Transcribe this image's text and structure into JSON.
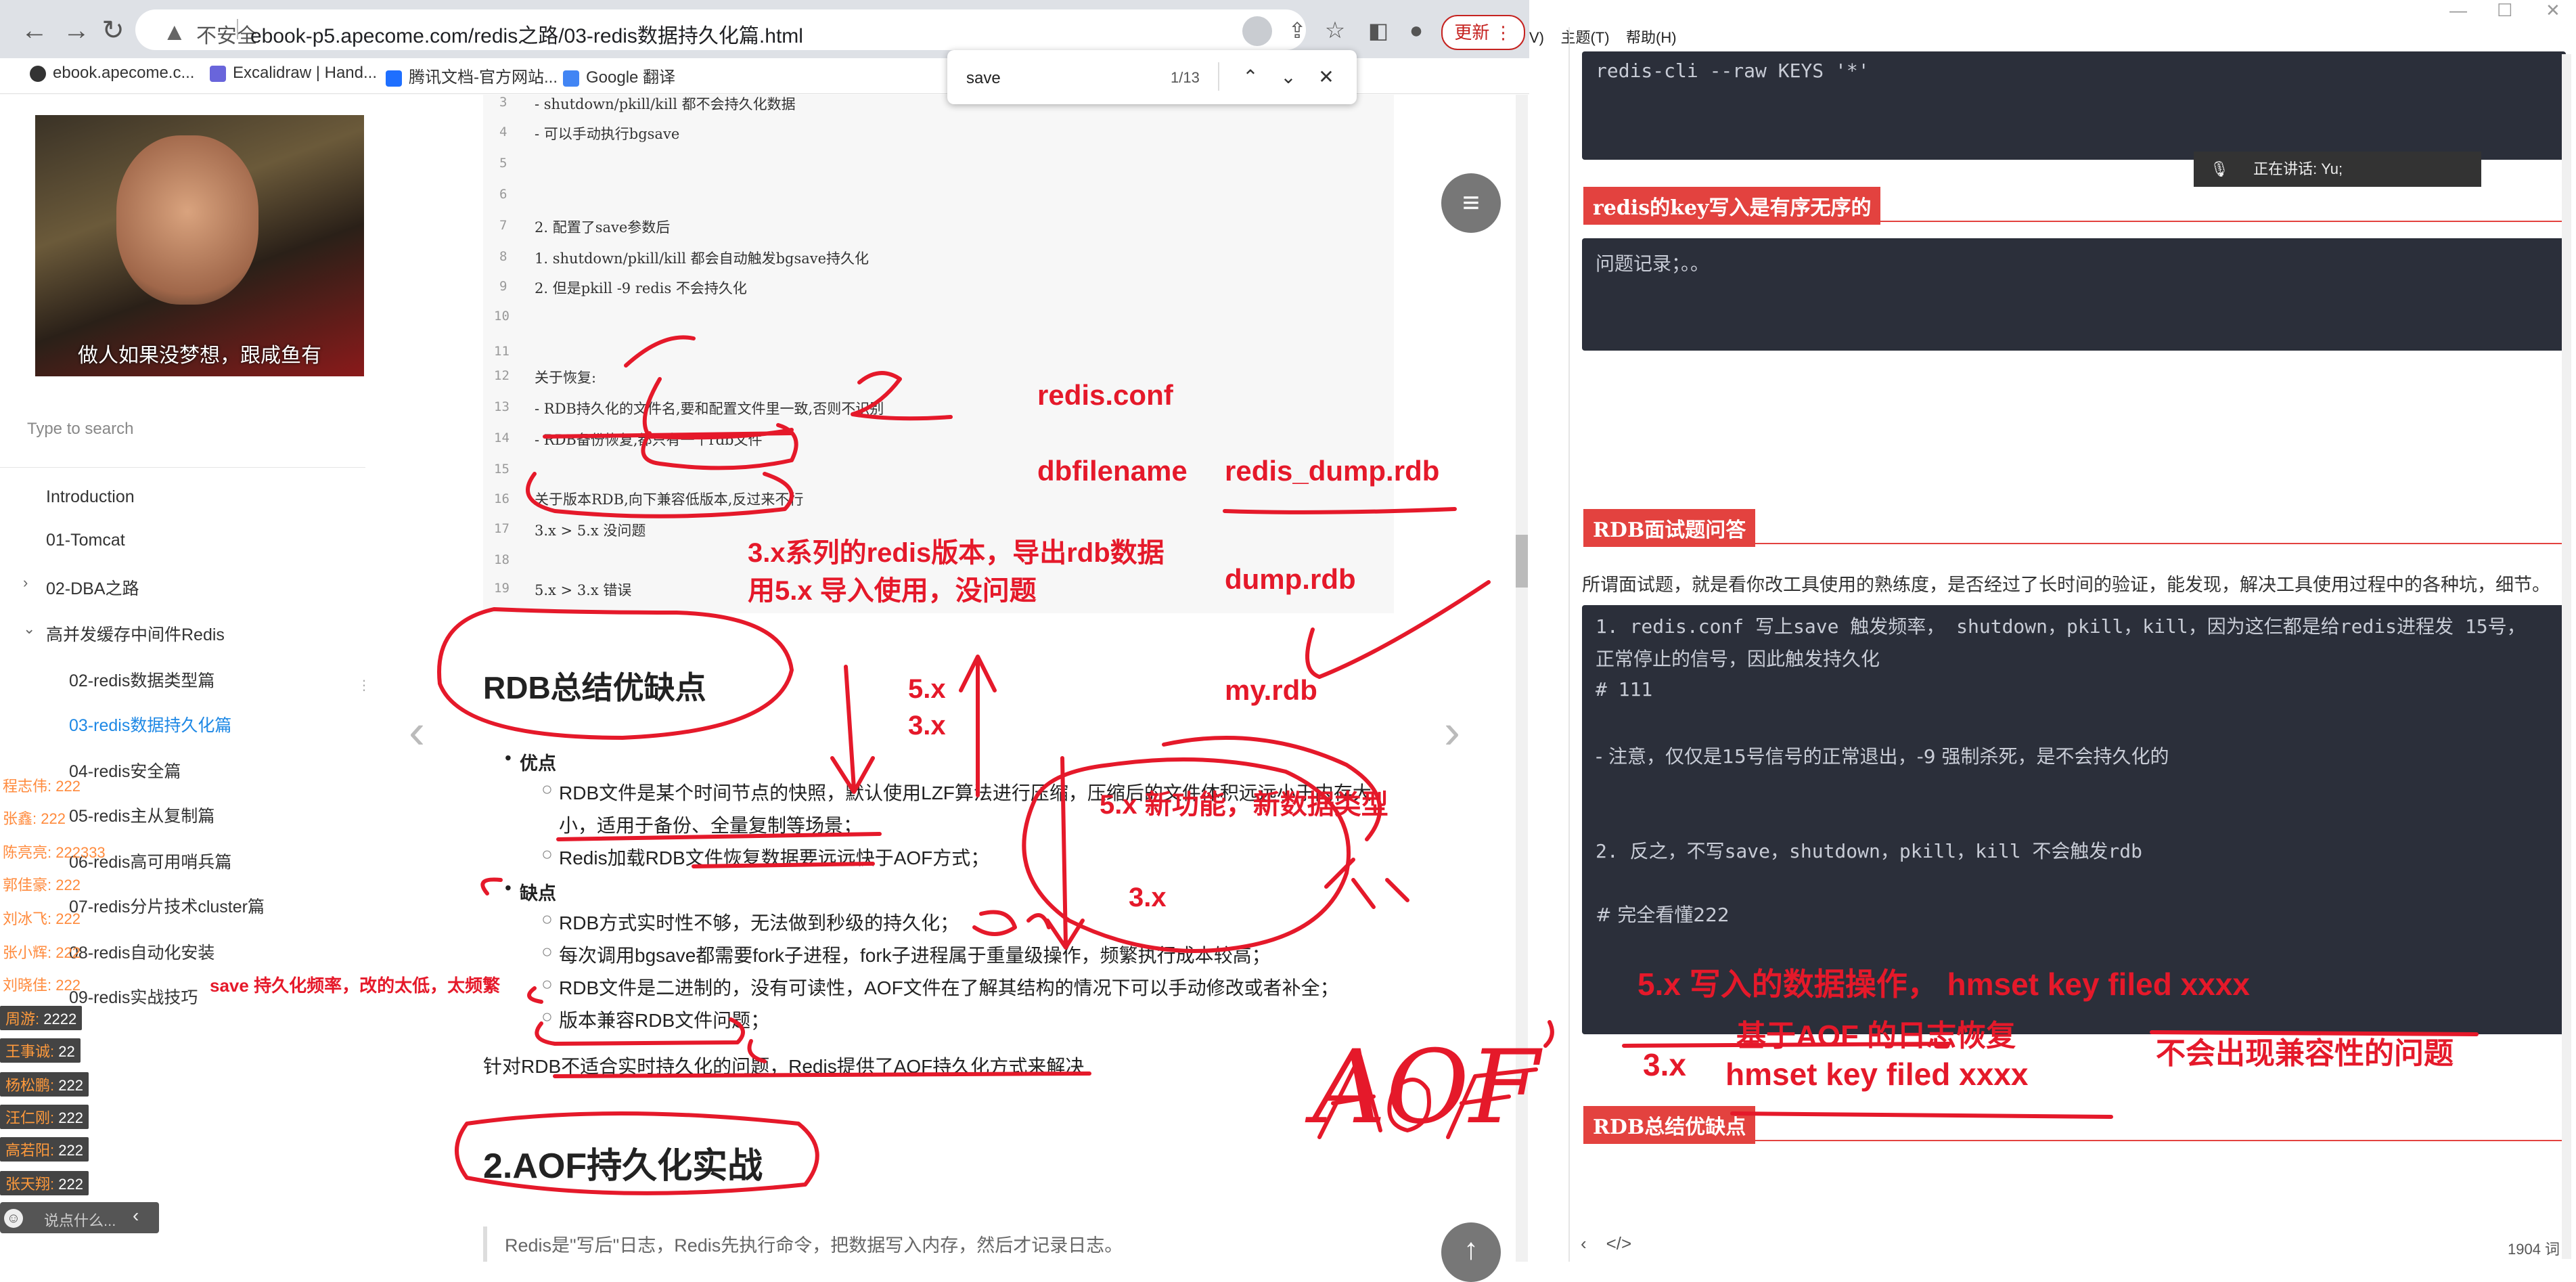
{
  "browser": {
    "not_secure": "不安全",
    "url": "ebook-p5.apecome.com/redis之路/03-redis数据持久化篇.html",
    "update_label": "更新",
    "bookmarks": [
      {
        "label": "ebook.apecome.c...",
        "color": "#333"
      },
      {
        "label": "Excalidraw | Hand...",
        "color": "#6965db"
      },
      {
        "label": "腾讯文档-官方网站...",
        "color": "#1e6fff"
      },
      {
        "label": "Google 翻译",
        "color": "#4285f4"
      }
    ],
    "find": {
      "query": "save",
      "count": "1/13"
    }
  },
  "sidebar": {
    "cover_caption": "做人如果没梦想，跟咸鱼有",
    "search_placeholder": "Type to search",
    "items": [
      {
        "label": "Introduction"
      },
      {
        "label": "01-Tomcat"
      },
      {
        "label": "02-DBA之路"
      },
      {
        "label": "高并发缓存中间件Redis"
      },
      {
        "label": "02-redis数据类型篇"
      },
      {
        "label": "03-redis数据持久化篇"
      },
      {
        "label": "04-redis安全篇"
      },
      {
        "label": "05-redis主从复制篇"
      },
      {
        "label": "06-redis高可用哨兵篇"
      },
      {
        "label": "07-redis分片技术cluster篇"
      },
      {
        "label": "08-redis自动化安装"
      },
      {
        "label": "09-redis实战技巧"
      }
    ],
    "chat": [
      {
        "name": "程志伟:",
        "text": "222"
      },
      {
        "name": "张鑫:",
        "text": "222"
      },
      {
        "name": "陈亮亮:",
        "text": "222333"
      },
      {
        "name": "郭佳豪:",
        "text": "222"
      },
      {
        "name": "刘冰飞:",
        "text": "222"
      },
      {
        "name": "张小辉:",
        "text": "222"
      },
      {
        "name": "刘晓佳:",
        "text": "222"
      },
      {
        "name": "周游:",
        "text": "2222"
      },
      {
        "name": "王事诚:",
        "text": "22"
      },
      {
        "name": "杨松鹏:",
        "text": "222"
      },
      {
        "name": "汪仁刚:",
        "text": "222"
      },
      {
        "name": "高若阳:",
        "text": "222"
      },
      {
        "name": "张天翔:",
        "text": "222"
      }
    ],
    "chat_placeholder": "说点什么..."
  },
  "code": {
    "lines": [
      {
        "n": "3",
        "t": "-  shutdown/pkill/kill 都不会持久化数据"
      },
      {
        "n": "4",
        "t": "- 可以手动执行bgsave"
      },
      {
        "n": "5",
        "t": ""
      },
      {
        "n": "6",
        "t": ""
      },
      {
        "n": "7",
        "t": "2. 配置了save参数后"
      },
      {
        "n": "8",
        "t": "1. shutdown/pkill/kill 都会自动触发bgsave持久化"
      },
      {
        "n": "9",
        "t": "2. 但是pkill -9 redis 不会持久化"
      },
      {
        "n": "10",
        "t": ""
      },
      {
        "n": "11",
        "t": ""
      },
      {
        "n": "12",
        "t": "关于恢复:"
      },
      {
        "n": "13",
        "t": "- RDB持久化的文件名,要和配置文件里一致,否则不识别"
      },
      {
        "n": "14",
        "t": "- RDB备份恢复,都只有一个rdb文件"
      },
      {
        "n": "15",
        "t": ""
      },
      {
        "n": "16",
        "t": "关于版本RDB,向下兼容低版本,反过来不行"
      },
      {
        "n": "17",
        "t": "3.x > 5.x  没问题"
      },
      {
        "n": "18",
        "t": ""
      },
      {
        "n": "19",
        "t": "5.x > 3.x 错误"
      }
    ]
  },
  "article": {
    "heading_rdb": "RDB总结优缺点",
    "pros_label": "优点",
    "pros": [
      "RDB文件是某个时间节点的快照，默认使用LZF算法进行压缩，压缩后的文件体积远远小于内存大",
      "小，适用于备份、全量复制等场景；",
      "Redis加载RDB文件恢复数据要远远快于AOF方式；"
    ],
    "cons_label": "缺点",
    "cons": [
      "RDB方式实时性不够，无法做到秒级的持久化；",
      "每次调用bgsave都需要fork子进程，fork子进程属于重量级操作，频繁执行成本较高；",
      "RDB文件是二进制的，没有可读性，AOF文件在了解其结构的情况下可以手动修改或者补全；",
      "版本兼容RDB文件问题；"
    ],
    "summary": "针对RDB不适合实时持久化的问题，Redis提供了AOF持久化方式来解决",
    "heading_aof": "2.AOF持久化实战",
    "quote": "Redis是\"写后\"日志，Redis先执行命令，把数据写入内存，然后才记录日志。"
  },
  "annotations": {
    "redis_conf": "redis.conf",
    "dbfilename": "dbfilename",
    "redis_dump": "redis_dump.rdb",
    "note_3x_1": "3.x系列的redis版本，导出rdb数据",
    "note_3x_2": "用5.x 导入使用，没问题",
    "dump_rdb": "dump.rdb",
    "v5x": "5.x",
    "v3x": "3.x",
    "my_rdb": "my.rdb",
    "new_feature": "5.x 新功能，新数据类型",
    "v3x_2": "3.x",
    "save_note": "save 持久化频率，改的太低，太频繁",
    "aof": "AOF",
    "w1": "5.x   写入的数据操作，  hmset key  filed xxxx",
    "w2": "基于AOF 的日志恢复",
    "w3": "3.x",
    "w4": "hmset key  filed xxxx",
    "w5": "不会出现兼容性的问题"
  },
  "editor": {
    "menus": [
      "V)",
      "主题(T)",
      "帮助(H)"
    ],
    "cmd": "redis-cli --raw KEYS '*'",
    "speaking": "正在讲话: Yu;",
    "h_order": "redis的key写入是有序无序的",
    "problem": "问题记录；。。",
    "h_interview": "RDB面试题问答",
    "intro": "所谓面试题，就是看你改工具使用的熟练度，是否经过了长时间的验证，能发现，解决工具使用过程中的各种坑，细节。",
    "answer_lines": [
      "1. redis.conf 写上save 触发频率，  shutdown，pkill，kill，因为这仨都是给redis进程发 15号，",
      "正常停止的信号，因此触发持久化",
      "# 111",
      "",
      "- 注意，仅仅是15号信号的正常退出，-9 强制杀死，是不会持久化的",
      "",
      "",
      "2. 反之，不写save，shutdown，pkill，kill 不会触发rdb",
      "",
      "# 完全看懂222"
    ],
    "h_summary": "RDB总结优缺点",
    "word_count": "1904 词"
  }
}
